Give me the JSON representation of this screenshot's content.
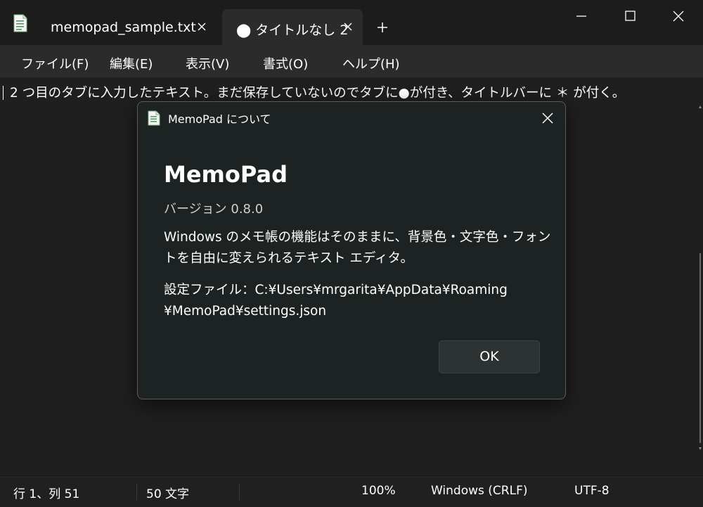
{
  "titlebar": {
    "app_icon": "notepad-icon",
    "tabs": [
      {
        "label": "memopad_sample.txt",
        "active": false
      },
      {
        "label": "⬤ タイトルなし 2",
        "active": true
      }
    ],
    "new_tab_icon": "plus-icon",
    "window_controls": [
      "minimize-icon",
      "maximize-icon",
      "close-icon"
    ]
  },
  "menu": {
    "items": [
      "ファイル(F)",
      "編集(E)",
      "表示(V)",
      "書式(O)",
      "ヘルプ(H)"
    ]
  },
  "editor": {
    "text": "2 つ目のタブに入力したテキスト。まだ保存していないのでタブに●が付き、タイトルバーに ＊ が付く。"
  },
  "dialog": {
    "title": "MemoPad について",
    "app_name": "MemoPad",
    "version": "バージョン 0.8.0",
    "description_lines": [
      "Windows のメモ帳の機能はそのままに、背景色・文字色・フォン",
      "トを自由に変えられるテキスト エディタ。"
    ],
    "settings_path_lines": [
      "設定ファイル：C:¥Users¥mrgarita¥AppData¥Roaming",
      "¥MemoPad¥settings.json"
    ],
    "ok_label": "OK"
  },
  "status": {
    "position": "行 1、列 51",
    "char_count": "50 文字",
    "zoom": "100%",
    "line_ending": "Windows (CRLF)",
    "encoding": "UTF-8"
  },
  "colors": {
    "background": "#1f1f1f",
    "menubar": "#2b2b2b",
    "dialog_bg": "#1d2322",
    "text": "#ffffff"
  }
}
